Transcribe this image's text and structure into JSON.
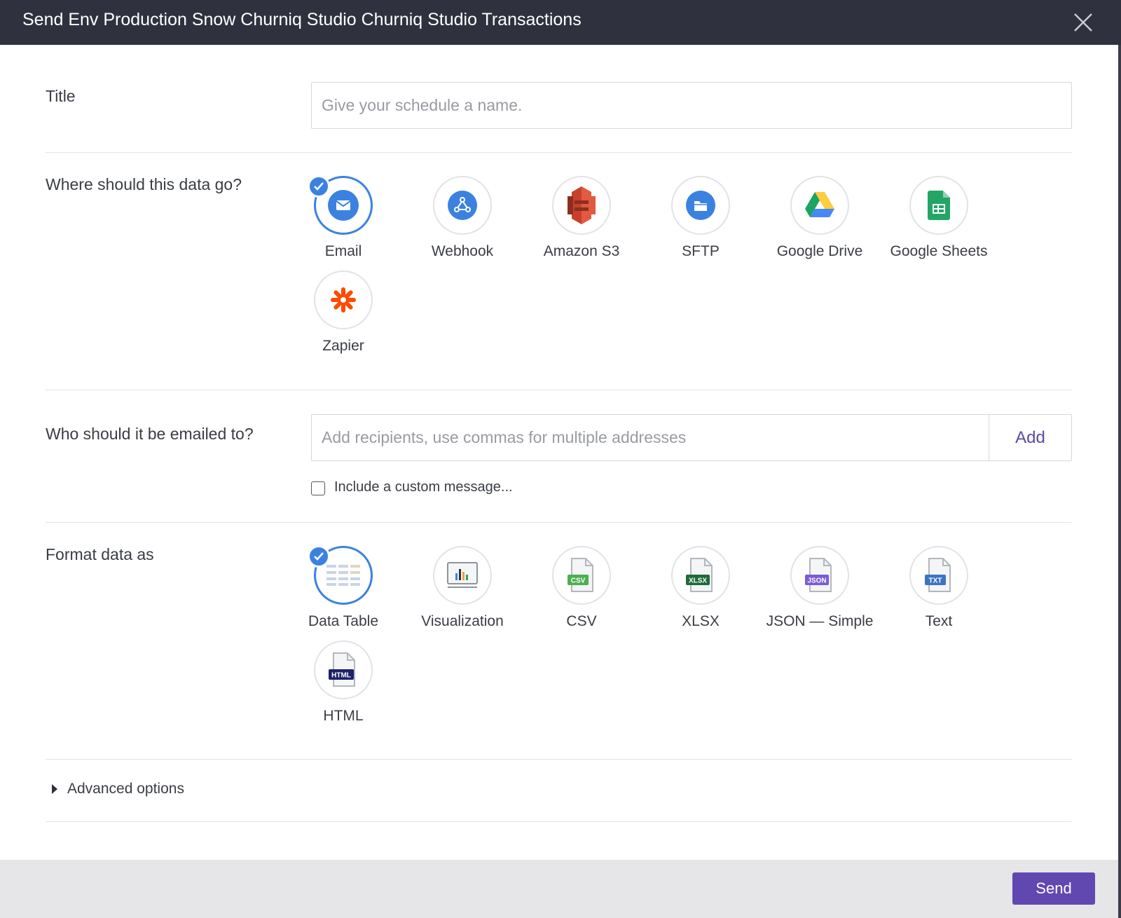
{
  "header": {
    "title": "Send Env Production Snow Churniq Studio Churniq Studio Transactions"
  },
  "title_section": {
    "label": "Title",
    "placeholder": "Give your schedule a name."
  },
  "destination_section": {
    "label": "Where should this data go?",
    "options": [
      {
        "label": "Email",
        "icon": "email-icon",
        "selected": true
      },
      {
        "label": "Webhook",
        "icon": "webhook-icon",
        "selected": false
      },
      {
        "label": "Amazon S3",
        "icon": "amazon-s3-icon",
        "selected": false
      },
      {
        "label": "SFTP",
        "icon": "sftp-icon",
        "selected": false
      },
      {
        "label": "Google Drive",
        "icon": "google-drive-icon",
        "selected": false
      },
      {
        "label": "Google Sheets",
        "icon": "google-sheets-icon",
        "selected": false
      },
      {
        "label": "Zapier",
        "icon": "zapier-icon",
        "selected": false
      }
    ]
  },
  "recipients_section": {
    "label": "Who should it be emailed to?",
    "placeholder": "Add recipients, use commas for multiple addresses",
    "add_label": "Add",
    "custom_message_label": "Include a custom message...",
    "custom_message_checked": false
  },
  "format_section": {
    "label": "Format data as",
    "options": [
      {
        "label": "Data Table",
        "icon": "data-table-icon",
        "selected": true
      },
      {
        "label": "Visualization",
        "icon": "visualization-icon",
        "selected": false
      },
      {
        "label": "CSV",
        "icon": "csv-file-icon",
        "badge": "CSV",
        "selected": false
      },
      {
        "label": "XLSX",
        "icon": "xlsx-file-icon",
        "badge": "XLSX",
        "selected": false
      },
      {
        "label": "JSON — Simple",
        "icon": "json-file-icon",
        "badge": "JSON",
        "selected": false
      },
      {
        "label": "Text",
        "icon": "text-file-icon",
        "badge": "TXT",
        "selected": false
      },
      {
        "label": "HTML",
        "icon": "html-file-icon",
        "badge": "HTML",
        "selected": false
      }
    ]
  },
  "advanced": {
    "label": "Advanced options"
  },
  "footer": {
    "send_label": "Send"
  },
  "colors": {
    "header_bg": "#2f323e",
    "accent_blue": "#3b82e0",
    "send_purple": "#6148b0",
    "add_text": "#5a4aa8",
    "csv_green": "#4caf50",
    "xlsx_green": "#1e6b3a",
    "json_purple": "#7b5cd6",
    "txt_blue": "#3d74c2",
    "html_navy": "#1e2266"
  }
}
